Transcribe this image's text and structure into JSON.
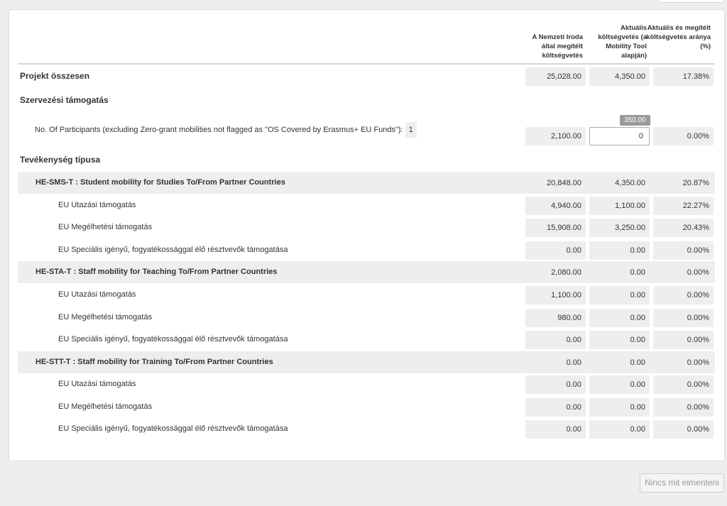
{
  "headers": {
    "col1": "A Nemzeti Iroda által megítélt költségvetés",
    "col2": "Aktuális költségvetés (a Mobility Tool alapján)",
    "col3": "Aktuális és megítélt költségvetés aránya (%)"
  },
  "total": {
    "label": "Projekt összesen",
    "v1": "25,028.00",
    "v2": "4,350.00",
    "v3": "17.38%"
  },
  "org_support": {
    "section_label": "Szervezési támogatás",
    "participants_label": "No. Of Participants (excluding Zero-grant mobilities not flagged as \"OS Covered by Erasmus+ EU Funds\"):",
    "participants_count": "1",
    "v1": "2,100.00",
    "input_value": "0",
    "tooltip": "350.00",
    "v3": "0.00%"
  },
  "activity_section_label": "Tevékenység típusa",
  "activities": [
    {
      "label": "HE-SMS-T : Student mobility for Studies To/From Partner Countries",
      "v1": "20,848.00",
      "v2": "4,350.00",
      "v3": "20.87%",
      "items": [
        {
          "label": "EU Utazási támogatás",
          "v1": "4,940.00",
          "v2": "1,100.00",
          "v3": "22.27%"
        },
        {
          "label": "EU Megélhetési támogatás",
          "v1": "15,908.00",
          "v2": "3,250.00",
          "v3": "20.43%"
        },
        {
          "label": "EU Speciális igényű, fogyatékossággal élő résztvevők támogatása",
          "v1": "0.00",
          "v2": "0.00",
          "v3": "0.00%"
        }
      ]
    },
    {
      "label": "HE-STA-T : Staff mobility for Teaching To/From Partner Countries",
      "v1": "2,080.00",
      "v2": "0.00",
      "v3": "0.00%",
      "items": [
        {
          "label": "EU Utazási támogatás",
          "v1": "1,100.00",
          "v2": "0.00",
          "v3": "0.00%"
        },
        {
          "label": "EU Megélhetési támogatás",
          "v1": "980.00",
          "v2": "0.00",
          "v3": "0.00%"
        },
        {
          "label": "EU Speciális igényű, fogyatékossággal élő résztvevők támogatása",
          "v1": "0.00",
          "v2": "0.00",
          "v3": "0.00%"
        }
      ]
    },
    {
      "label": "HE-STT-T : Staff mobility for Training To/From Partner Countries",
      "v1": "0.00",
      "v2": "0.00",
      "v3": "0.00%",
      "items": [
        {
          "label": "EU Utazási támogatás",
          "v1": "0.00",
          "v2": "0.00",
          "v3": "0.00%"
        },
        {
          "label": "EU Megélhetési támogatás",
          "v1": "0.00",
          "v2": "0.00",
          "v3": "0.00%"
        },
        {
          "label": "EU Speciális igényű, fogyatékossággal élő résztvevők támogatása",
          "v1": "0.00",
          "v2": "0.00",
          "v3": "0.00%"
        }
      ]
    }
  ],
  "save_button": "Nincs mit elmenteni"
}
